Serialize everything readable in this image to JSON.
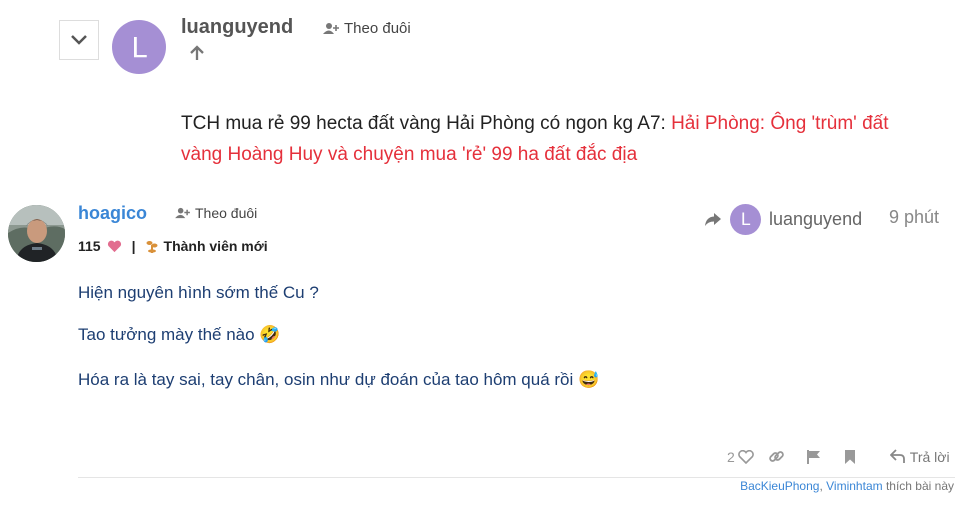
{
  "quoted_post": {
    "username": "luanguyend",
    "avatar_letter": "L",
    "follow_label": "Theo đuôi",
    "text_prefix": "TCH mua rẻ 99 hecta đất vàng Hải Phòng có ngon kg A7: ",
    "link_text": "Hải Phòng: Ông 'trùm' đất vàng Hoàng Huy và chuyện mua 'rẻ' 99 ha đất đắc địa"
  },
  "post": {
    "username": "hoagico",
    "follow_label": "Theo đuôi",
    "likes_count": "115",
    "rank": "Thành viên mới",
    "reply_to_user": "luanguyend",
    "reply_to_avatar_letter": "L",
    "time": "9 phút",
    "body": [
      "Hiện nguyên hình sớm thế Cu ?",
      "Tao tưởng mày thế nào 🤣",
      "Hóa ra là tay sai, tay chân, osin như dự đoán của tao hôm quá rồi 😅"
    ],
    "actions": {
      "like_count": "2",
      "reply_label": "Trả lời"
    },
    "liked_by": {
      "user1": "BacKieuPhong",
      "separator": ", ",
      "user2": "Viminhtam",
      "suffix": " thích bài này"
    }
  },
  "colors": {
    "link_red": "#e5303b",
    "username_blue": "#3a86d6",
    "body_navy": "#1d3e72",
    "avatar_purple": "#a58fd4",
    "heart_pink": "#e26d8f",
    "rank_orange": "#d9913a"
  },
  "icons": [
    "chevron-down-icon",
    "arrow-up-icon",
    "user-plus-icon",
    "heart-icon",
    "seedling-icon",
    "share-arrow-icon",
    "link-icon",
    "flag-icon",
    "bookmark-icon",
    "reply-arrow-icon"
  ]
}
